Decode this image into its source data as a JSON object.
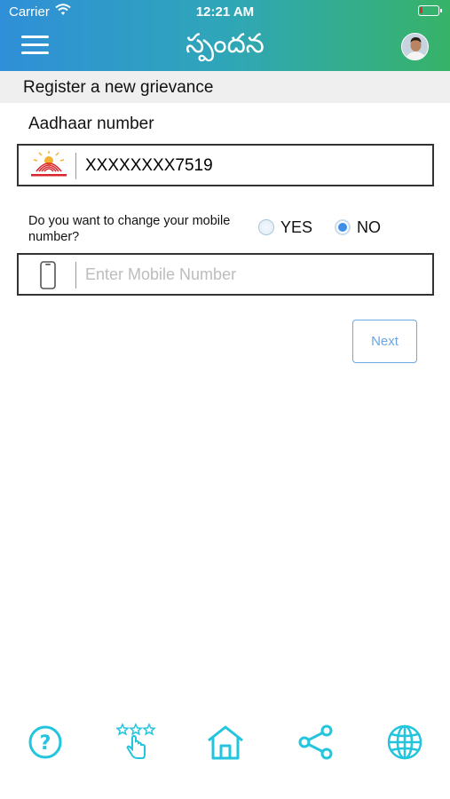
{
  "status_bar": {
    "carrier": "Carrier",
    "time": "12:21 AM",
    "battery_level": 0.15
  },
  "header": {
    "title": "స్పందన",
    "menu_icon": "hamburger-menu-icon",
    "avatar": "user-avatar"
  },
  "section": {
    "title": "Register a new grievance"
  },
  "aadhaar": {
    "label": "Aadhaar number",
    "value": "XXXXXXXX7519",
    "icon": "aadhaar-logo-icon"
  },
  "mobile_change": {
    "question": "Do you want to change your mobile number?",
    "options": [
      {
        "label": "YES",
        "selected": false
      },
      {
        "label": "NO",
        "selected": true
      }
    ]
  },
  "mobile_input": {
    "placeholder": "Enter Mobile Number",
    "value": "",
    "icon": "mobile-phone-icon"
  },
  "next_button": {
    "label": "Next"
  },
  "bottom_nav": [
    {
      "icon": "help-icon"
    },
    {
      "icon": "rating-icon"
    },
    {
      "icon": "home-icon"
    },
    {
      "icon": "share-icon"
    },
    {
      "icon": "language-globe-icon"
    }
  ],
  "colors": {
    "header_start": "#2f8fd8",
    "header_end": "#37b368",
    "accent": "#3d8fe8",
    "nav_icon": "#22c5dd"
  }
}
